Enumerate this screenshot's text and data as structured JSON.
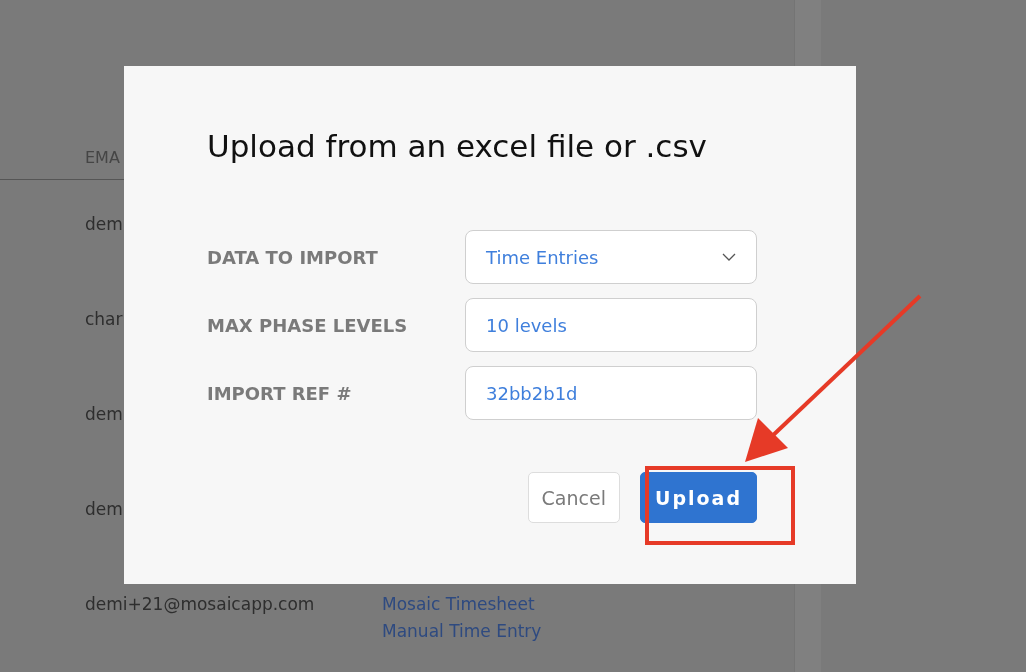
{
  "table": {
    "columns": [
      "EMA"
    ],
    "rows": [
      {
        "email": "dem",
        "links": []
      },
      {
        "email": "char",
        "links": []
      },
      {
        "email": "dem",
        "links": []
      },
      {
        "email": "dem",
        "links": []
      },
      {
        "email": "demi+21@mosaicapp.com",
        "links": [
          "Mosaic Timesheet",
          "Manual Time Entry"
        ]
      }
    ]
  },
  "dialog": {
    "title": "Upload from an excel file or .csv",
    "fields": [
      {
        "label": "DATA TO IMPORT",
        "value": "Time Entries",
        "kind": "select"
      },
      {
        "label": "MAX PHASE LEVELS",
        "value": "10 levels",
        "kind": "input"
      },
      {
        "label": "IMPORT REF #",
        "value": "32bb2b1d",
        "kind": "input"
      }
    ],
    "buttons": [
      {
        "label": "Cancel",
        "kind": "secondary"
      },
      {
        "label": "Upload",
        "kind": "primary"
      }
    ]
  }
}
